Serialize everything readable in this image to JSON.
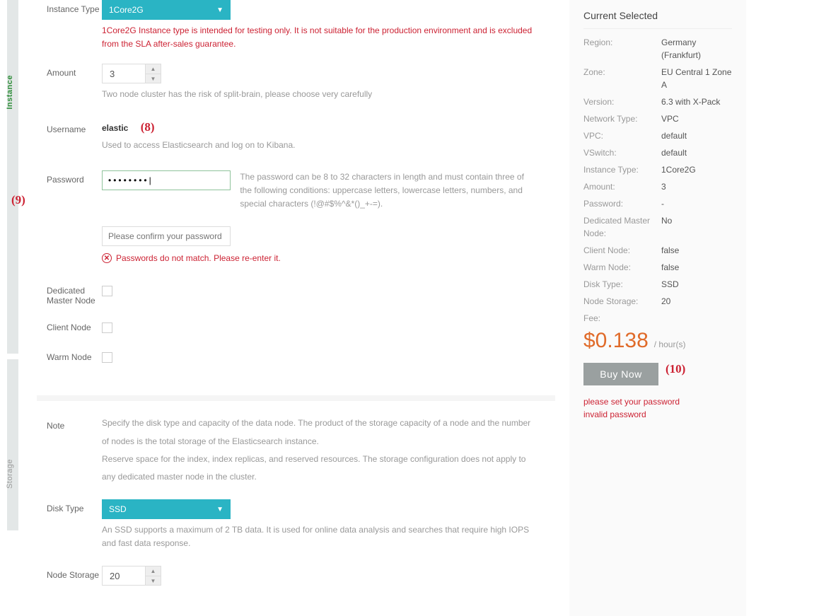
{
  "sections": {
    "instance_rail": "Instance",
    "storage_rail": "Storage"
  },
  "form": {
    "instance_type": {
      "label": "Instance Type",
      "value": "1Core2G",
      "warning": "1Core2G Instance type is intended for testing only. It is not suitable for the production environment and is excluded from the SLA after-sales guarantee."
    },
    "amount": {
      "label": "Amount",
      "value": "3",
      "help": "Two node cluster has the risk of split-brain, please choose very carefully"
    },
    "username": {
      "label": "Username",
      "value": "elastic",
      "help": "Used to access Elasticsearch and log on to Kibana."
    },
    "password": {
      "label": "Password",
      "value": "••••••••|",
      "rule": "The password can be 8 to 32 characters in length and must contain three of the following conditions: uppercase letters, lowercase letters, numbers, and special characters (!@#$%^&*()_+-=).",
      "confirm_placeholder": "Please confirm your password",
      "error": "Passwords do not match. Please re-enter it."
    },
    "dedicated_master": {
      "label": "Dedicated Master Node"
    },
    "client_node": {
      "label": "Client Node"
    },
    "warm_node": {
      "label": "Warm Node"
    },
    "note": {
      "label": "Note",
      "l1": "Specify the disk type and capacity of the data node. The product of the storage capacity of a node and the number",
      "l2": "of nodes is the total storage of the Elasticsearch instance.",
      "l3": "Reserve space for the index, index replicas, and reserved resources. The storage configuration does not apply to",
      "l4": "any dedicated master node in the cluster."
    },
    "disk_type": {
      "label": "Disk Type",
      "value": "SSD",
      "help": "An SSD supports a maximum of 2 TB data. It is used for online data analysis and searches that require high IOPS and fast data response."
    },
    "node_storage": {
      "label": "Node Storage",
      "value": "20"
    }
  },
  "annotations": {
    "a8": "(8)",
    "a9": "(9)",
    "a10": "(10)"
  },
  "sidebar": {
    "title": "Current Selected",
    "rows": {
      "region": {
        "k": "Region:",
        "v": "Germany (Frankfurt)"
      },
      "zone": {
        "k": "Zone:",
        "v": "EU Central 1 Zone A"
      },
      "version": {
        "k": "Version:",
        "v": "6.3 with X-Pack"
      },
      "network": {
        "k": "Network Type:",
        "v": "VPC"
      },
      "vpc": {
        "k": "VPC:",
        "v": "default"
      },
      "vswitch": {
        "k": "VSwitch:",
        "v": "default"
      },
      "itype": {
        "k": "Instance Type:",
        "v": "1Core2G"
      },
      "amount": {
        "k": "Amount:",
        "v": "3"
      },
      "password": {
        "k": "Password:",
        "v": "-"
      },
      "dmaster": {
        "k": "Dedicated Master Node:",
        "v": "No"
      },
      "client": {
        "k": "Client Node:",
        "v": "false"
      },
      "warm": {
        "k": "Warm Node:",
        "v": "false"
      },
      "dtype": {
        "k": "Disk Type:",
        "v": "SSD"
      },
      "nstorage": {
        "k": "Node Storage:",
        "v": "20"
      },
      "fee_label": "Fee:"
    },
    "fee": {
      "amount": "$0.138",
      "unit": "/ hour(s)"
    },
    "buy": "Buy Now",
    "errors": {
      "e1": "please set your password",
      "e2": "invalid password"
    }
  }
}
